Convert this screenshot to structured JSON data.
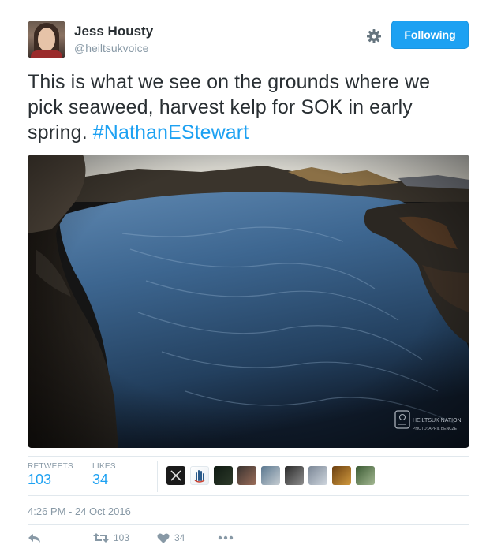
{
  "author": {
    "name": "Jess Housty",
    "handle": "@heiltsukvoice"
  },
  "follow_button": "Following",
  "tweet": {
    "text": "This is what we see on the grounds where we pick seaweed, harvest kelp for SOK in early spring. ",
    "hashtag": "#NathanEStewart"
  },
  "media": {
    "watermark_line1": "HEILTSUK NATION",
    "watermark_line2": "PHOTO: APRIL BENCZE"
  },
  "stats": {
    "retweets_label": "RETWEETS",
    "retweets_value": "103",
    "likes_label": "LIKES",
    "likes_value": "34"
  },
  "likers": [
    {
      "icon": "x-logo-avatar",
      "colors": [
        "#1a1a1a",
        "#1a1a1a"
      ]
    },
    {
      "icon": "hand-logo-avatar",
      "colors": [
        "#ffffff",
        "#e9eef3"
      ]
    },
    {
      "icon": "night-sky-avatar",
      "colors": [
        "#0f1a12",
        "#2d3a2a"
      ]
    },
    {
      "icon": "group-photo-avatar",
      "colors": [
        "#3a3330",
        "#9c6e5a"
      ]
    },
    {
      "icon": "ocean-avatar",
      "colors": [
        "#5b7890",
        "#c6cdd2"
      ]
    },
    {
      "icon": "rock-avatar",
      "colors": [
        "#2a2a2a",
        "#8d8d8d"
      ]
    },
    {
      "icon": "landscape-avatar",
      "colors": [
        "#7b8796",
        "#cfd6de"
      ]
    },
    {
      "icon": "golden-avatar",
      "colors": [
        "#6b3f10",
        "#d19a3e"
      ]
    },
    {
      "icon": "forest-avatar",
      "colors": [
        "#3b5a33",
        "#a3b892"
      ]
    }
  ],
  "timestamp": "4:26 PM - 24 Oct 2016",
  "actions": {
    "retweet_count": "103",
    "like_count": "34"
  },
  "colors": {
    "accent": "#1da1f2",
    "text": "#292f33",
    "muted": "#8899a6"
  }
}
